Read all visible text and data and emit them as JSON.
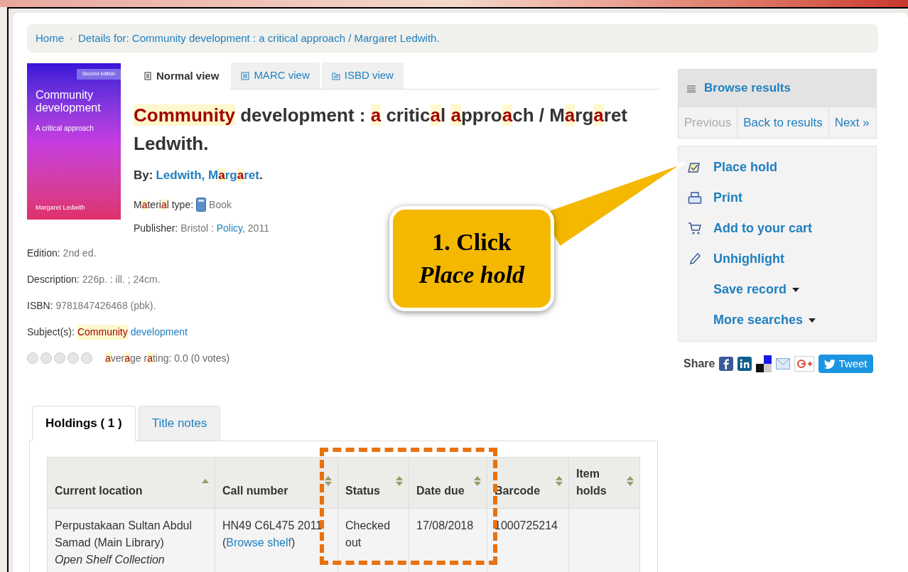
{
  "breadcrumb": [
    {
      "label": "Home"
    },
    {
      "label": "›",
      "kind": "separator"
    },
    {
      "label": "Details for: Community development : a critical approach / Margaret Ledwith."
    }
  ],
  "cover": {
    "badge": "Second edition",
    "title": "Community development",
    "subtitle": "A critical approach",
    "author": "Margaret Ledwith"
  },
  "view_tabs": [
    {
      "label": "Normal view",
      "selected": true
    },
    {
      "label": "MARC view",
      "selected": false
    },
    {
      "label": "ISBD view",
      "selected": false
    }
  ],
  "title": [
    {
      "text": "Community",
      "highlighted": true
    },
    {
      "text": " development : ",
      "highlighted": false
    },
    {
      "text": "a",
      "highlighted": true
    },
    {
      "text": " critic",
      "highlighted": false
    },
    {
      "text": "a",
      "highlighted": true
    },
    {
      "text": "l ",
      "highlighted": false
    },
    {
      "text": "a",
      "highlighted": true
    },
    {
      "text": "ppro",
      "highlighted": false
    },
    {
      "text": "a",
      "highlighted": true
    },
    {
      "text": "ch / M",
      "highlighted": false
    },
    {
      "text": "a",
      "highlighted": true
    },
    {
      "text": "rg",
      "highlighted": false
    },
    {
      "text": "a",
      "highlighted": true
    },
    {
      "text": "ret Ledwith.",
      "highlighted": false
    }
  ],
  "by_label": "By:",
  "author": [
    {
      "text": "Ledwith, M",
      "highlighted": false
    },
    {
      "text": "a",
      "highlighted": true
    },
    {
      "text": "rg",
      "highlighted": false
    },
    {
      "text": "a",
      "highlighted": true
    },
    {
      "text": "ret",
      "highlighted": false
    }
  ],
  "author_end": ".",
  "material_label": [
    {
      "text": "M",
      "highlighted": false
    },
    {
      "text": "a",
      "highlighted": true
    },
    {
      "text": "teri",
      "highlighted": false
    },
    {
      "text": "a",
      "highlighted": true
    },
    {
      "text": "l type:",
      "highlighted": false
    }
  ],
  "material_value": "Book",
  "publisher": {
    "label": "Publisher:",
    "place": "Bristol :",
    "name": "Policy,",
    "year": "2011"
  },
  "fields": [
    {
      "label": "Edition:",
      "value": "2nd ed."
    },
    {
      "label": "Description:",
      "value": "226p. : ill. ; 24cm."
    },
    {
      "label": "ISBN:",
      "value": "9781847426468 (pbk)."
    }
  ],
  "subjects": {
    "label": "Subject(s):",
    "links": [
      {
        "text": "Community",
        "highlighted": true
      },
      {
        "text": "development",
        "highlighted": false
      }
    ]
  },
  "rating": {
    "stars": 0,
    "text": [
      {
        "text": "a",
        "highlighted": true
      },
      {
        "text": "ver",
        "highlighted": false
      },
      {
        "text": "a",
        "highlighted": true
      },
      {
        "text": "ge r",
        "highlighted": false
      },
      {
        "text": "a",
        "highlighted": true
      },
      {
        "text": "ting: 0.0 (0 votes)",
        "highlighted": false
      }
    ]
  },
  "holdings_tabs": [
    {
      "label": "Holdings ( 1 )",
      "selected": true
    },
    {
      "label": "Title notes",
      "selected": false
    }
  ],
  "table": {
    "columns": [
      "Current location",
      "Call number",
      "Status",
      "Date due",
      "Barcode",
      "Item holds"
    ],
    "rows": [
      {
        "location": "Perpustakaan Sultan Abdul Samad (Main Library)",
        "collection": "Open Shelf Collection",
        "call_number": "HN49 C6L475 2011",
        "browse_open": "(",
        "browse_link": "Browse shelf",
        "browse_close": ")",
        "status": "Checked out",
        "date_due": "17/08/2018",
        "barcode": "1000725214"
      }
    ]
  },
  "browse": {
    "title": "Browse results",
    "nav": [
      {
        "label": "Previous",
        "disabled": true
      },
      {
        "label": "Back to results",
        "disabled": false
      },
      {
        "label": "Next »",
        "disabled": false
      }
    ]
  },
  "actions": [
    {
      "kind": "hold",
      "label": "Place hold",
      "dropdown": false
    },
    {
      "kind": "print",
      "label": "Print",
      "dropdown": false
    },
    {
      "kind": "cart",
      "label": "Add to your cart",
      "dropdown": false
    },
    {
      "kind": "highlight",
      "label": "Unhighlight",
      "dropdown": false
    },
    {
      "kind": "none",
      "label": "Save record",
      "dropdown": true
    },
    {
      "kind": "none",
      "label": "More searches",
      "dropdown": true
    }
  ],
  "share": {
    "label": "Share",
    "tweet": "Tweet"
  },
  "callout": {
    "line1": "1. Click",
    "line2": "Place hold"
  }
}
